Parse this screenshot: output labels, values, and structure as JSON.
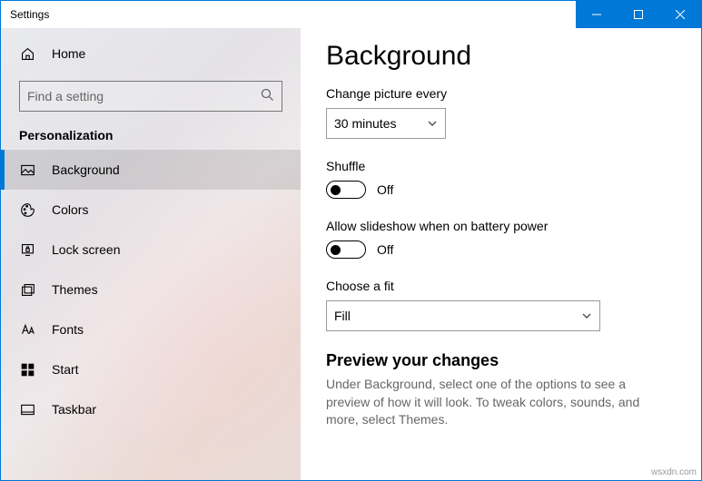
{
  "titlebar": {
    "title": "Settings"
  },
  "sidebar": {
    "home": "Home",
    "search_placeholder": "Find a setting",
    "section": "Personalization",
    "items": [
      {
        "label": "Background"
      },
      {
        "label": "Colors"
      },
      {
        "label": "Lock screen"
      },
      {
        "label": "Themes"
      },
      {
        "label": "Fonts"
      },
      {
        "label": "Start"
      },
      {
        "label": "Taskbar"
      }
    ]
  },
  "main": {
    "heading": "Background",
    "change_label": "Change picture every",
    "change_value": "30 minutes",
    "shuffle_label": "Shuffle",
    "shuffle_state": "Off",
    "battery_label": "Allow slideshow when on battery power",
    "battery_state": "Off",
    "fit_label": "Choose a fit",
    "fit_value": "Fill",
    "preview_heading": "Preview your changes",
    "preview_body": "Under Background, select one of the options to see a preview of how it will look. To tweak colors, sounds, and more, select Themes."
  },
  "watermark": "wsxdn.com"
}
